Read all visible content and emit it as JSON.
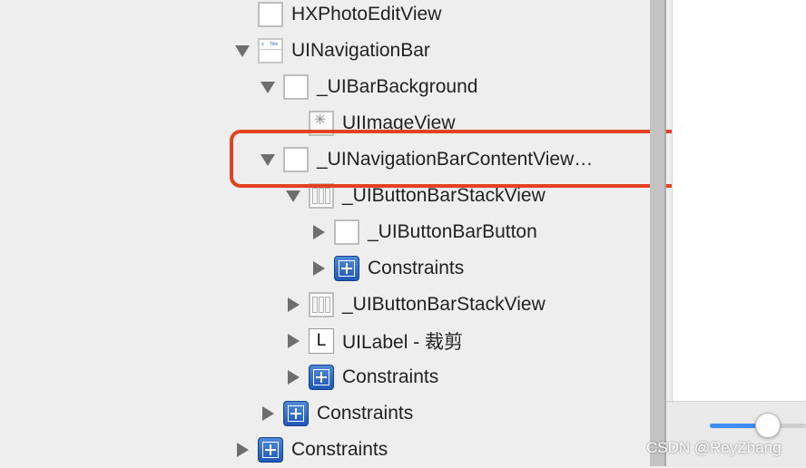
{
  "outline": {
    "items": [
      {
        "label": "HXPhotoEditView",
        "icon": "view-icon",
        "disclosure": "none"
      },
      {
        "label": "UINavigationBar",
        "icon": "navigation-bar-icon",
        "disclosure": "expanded",
        "icon_text": {
          "chevron": "‹",
          "title": "Title"
        }
      },
      {
        "label": "_UIBarBackground",
        "icon": "view-icon",
        "disclosure": "expanded"
      },
      {
        "label": "UIImageView",
        "icon": "image-view-icon",
        "disclosure": "none"
      },
      {
        "label": "_UINavigationBarContentView…",
        "icon": "view-icon",
        "disclosure": "expanded",
        "highlighted": true
      },
      {
        "label": "_UIButtonBarStackView",
        "icon": "stack-view-icon",
        "disclosure": "expanded"
      },
      {
        "label": "_UIButtonBarButton",
        "icon": "view-icon",
        "disclosure": "collapsed"
      },
      {
        "label": "Constraints",
        "icon": "constraints-icon",
        "disclosure": "collapsed"
      },
      {
        "label": "_UIButtonBarStackView",
        "icon": "stack-view-icon",
        "disclosure": "collapsed"
      },
      {
        "label": "UILabel - 裁剪",
        "icon": "label-icon",
        "icon_text": "L",
        "disclosure": "collapsed"
      },
      {
        "label": "Constraints",
        "icon": "constraints-icon",
        "disclosure": "collapsed"
      },
      {
        "label": "Constraints",
        "icon": "constraints-icon",
        "disclosure": "collapsed"
      },
      {
        "label": "Constraints",
        "icon": "constraints-icon",
        "disclosure": "collapsed"
      }
    ]
  },
  "slider": {
    "value": 0.6
  },
  "highlight_color": "#e4411f",
  "accent_color": "#3d8cf1",
  "watermark": "CSDN @ReyZhang"
}
